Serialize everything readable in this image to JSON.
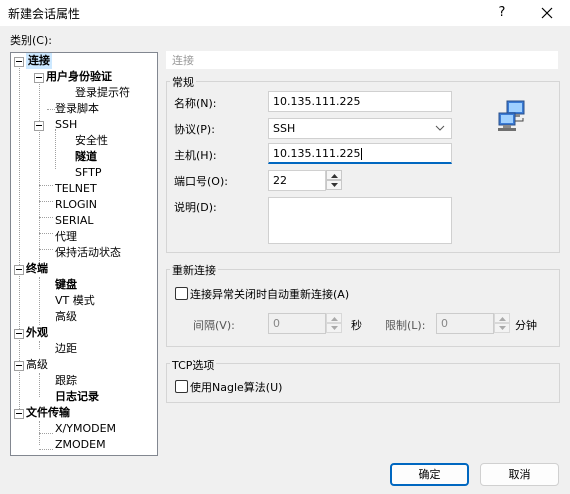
{
  "window": {
    "title": "新建会话属性",
    "help_label": "?"
  },
  "sidebar": {
    "category_label": "类别(C):",
    "items": [
      {
        "label": "连接",
        "bold": true
      },
      {
        "label": "用户身份验证",
        "bold": true
      },
      {
        "label": "登录提示符",
        "bold": false
      },
      {
        "label": "登录脚本",
        "bold": false
      },
      {
        "label": "SSH",
        "bold": false
      },
      {
        "label": "安全性",
        "bold": false
      },
      {
        "label": "隧道",
        "bold": true
      },
      {
        "label": "SFTP",
        "bold": false
      },
      {
        "label": "TELNET",
        "bold": false
      },
      {
        "label": "RLOGIN",
        "bold": false
      },
      {
        "label": "SERIAL",
        "bold": false
      },
      {
        "label": "代理",
        "bold": false
      },
      {
        "label": "保持活动状态",
        "bold": false
      },
      {
        "label": "终端",
        "bold": true
      },
      {
        "label": "键盘",
        "bold": true
      },
      {
        "label": "VT 模式",
        "bold": false
      },
      {
        "label": "高级",
        "bold": false
      },
      {
        "label": "外观",
        "bold": true
      },
      {
        "label": "边距",
        "bold": false
      },
      {
        "label": "高级",
        "bold": false
      },
      {
        "label": "跟踪",
        "bold": false
      },
      {
        "label": "日志记录",
        "bold": true
      },
      {
        "label": "文件传输",
        "bold": true
      },
      {
        "label": "X/YMODEM",
        "bold": false
      },
      {
        "label": "ZMODEM",
        "bold": false
      }
    ]
  },
  "panel": {
    "header": "连接",
    "general": {
      "title": "常规",
      "name_label": "名称(N):",
      "name_value": "10.135.111.225",
      "protocol_label": "协议(P):",
      "protocol_value": "SSH",
      "host_label": "主机(H):",
      "host_value": "10.135.111.225",
      "port_label": "端口号(O):",
      "port_value": "22",
      "desc_label": "说明(D):",
      "desc_value": ""
    },
    "reconnect": {
      "title": "重新连接",
      "checkbox_label": "连接异常关闭时自动重新连接(A)",
      "interval_label": "间隔(V):",
      "interval_value": "0",
      "interval_unit": "秒",
      "limit_label": "限制(L):",
      "limit_value": "0",
      "limit_unit": "分钟"
    },
    "tcp": {
      "title": "TCP选项",
      "checkbox_label": "使用Nagle算法(U)"
    }
  },
  "footer": {
    "ok_label": "确定",
    "cancel_label": "取消"
  },
  "colors": {
    "accent": "#0067c0",
    "selection": "#cce8ff"
  },
  "icons": {
    "network": "network-computers-icon",
    "close": "close-icon",
    "chevron": "chevron-down-icon"
  }
}
